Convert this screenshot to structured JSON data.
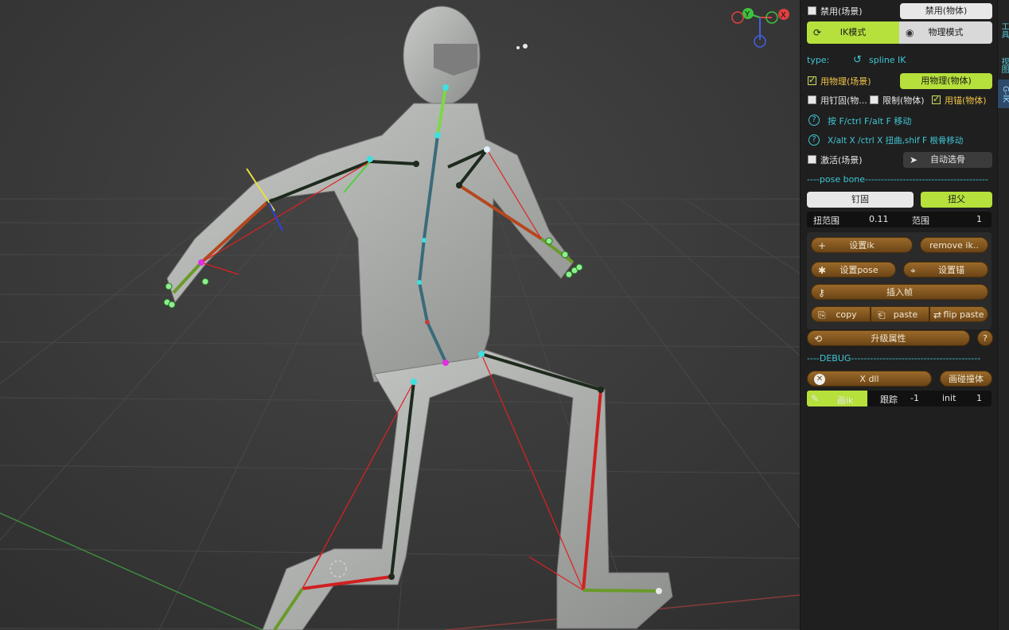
{
  "panel": {
    "disable_scene_label": "禁用(场景)",
    "disable_object_btn": "禁用(物体)",
    "ik_mode_btn": "IK模式",
    "physics_mode_btn": "物理模式",
    "type_label": "type:",
    "type_value": "spline IK",
    "use_physics_scene": "用物理(场景)",
    "use_physics_object_btn": "用物理(物体)",
    "use_pin_object": "用钉固(物...",
    "limit_object": "限制(物体)",
    "use_anchor_object": "用锚(物体)",
    "help1": "按 F/ctrl F/alt F 移动",
    "help2": "X/alt X /ctrl X  扭曲,shif F 根骨移动",
    "activate_scene": "激活(场景)",
    "auto_select_bone_btn": "自动选骨",
    "pose_bone_sep": "----pose bone---------------------------------------",
    "pin_btn": "钉固",
    "twist_parent_btn": "扭父",
    "twist_range_label": "扭范围",
    "twist_range_value": "0.11",
    "range_label": "范围",
    "range_value": "1",
    "set_ik_btn": "设置ik",
    "remove_ik_btn": "remove ik..",
    "set_pose_btn": "设置pose",
    "set_anchor_btn": "设置锚",
    "insert_frame_btn": "插入帧",
    "copy_btn": "copy",
    "paste_btn": "paste",
    "flip_paste_btn": "flip paste",
    "upgrade_attr_btn": "升级属性",
    "debug_sep": "----DEBUG-----------------------------------------",
    "x_dll_btn": "X dll",
    "draw_collider_btn": "画碰撞体",
    "draw_ik_btn": "画ik",
    "track_label": "跟踪",
    "track_value": "-1",
    "init_label": "init",
    "init_value": "1"
  },
  "vtabs": [
    "工具",
    "视图",
    "G-IK"
  ],
  "gizmo": {
    "x": "X",
    "y": "Y"
  },
  "colors": {
    "accent_green": "#b6e03c",
    "cyan": "#3fc7d6",
    "yellow": "#f0c44a",
    "brown": "#7a5020"
  }
}
